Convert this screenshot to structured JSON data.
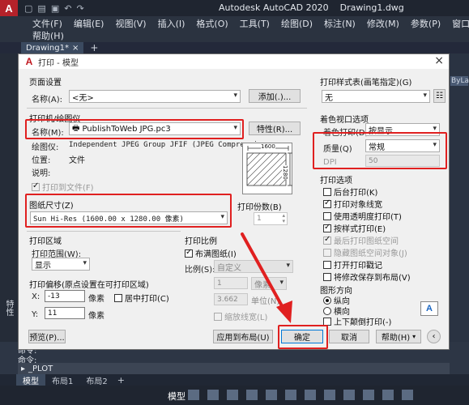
{
  "app": {
    "logo": "A",
    "title": "Autodesk AutoCAD 2020",
    "document": "Drawing1.dwg",
    "menu_row1": [
      "文件(F)",
      "编辑(E)",
      "视图(V)",
      "插入(I)",
      "格式(O)",
      "工具(T)",
      "绘图(D)",
      "标注(N)",
      "修改(M)",
      "参数(P)",
      "窗口(W)"
    ],
    "menu_row2": "帮助(H)",
    "file_tab": "Drawing1*",
    "file_tab_close": "×",
    "file_tab_plus": "+",
    "byla": "ByLa",
    "side_label": "特性",
    "command_history": [
      "命令:",
      "命令:"
    ],
    "command_input": "_PLOT",
    "layout_tabs": [
      "模型",
      "布局1",
      "布局2"
    ],
    "layout_plus": "+",
    "status_model": "模型"
  },
  "dialog": {
    "logo": "A",
    "title": "打印 - 模型",
    "close": "×",
    "page_setup": {
      "section": "页面设置",
      "name_label": "名称(A):",
      "name_value": "<无>",
      "add_button": "添加(.)..."
    },
    "printer": {
      "section": "打印机/绘图仪",
      "name_label": "名称(M):",
      "name_value": "PublishToWeb JPG.pc3",
      "properties_button": "特性(R)...",
      "plotter_label": "绘图仪:",
      "plotter_value": "Independent JPEG Group JFIF (JPEG Compressi...",
      "location_label": "位置:",
      "location_value": "文件",
      "description_label": "说明:",
      "plot_to_file": "打印到文件(F)",
      "preview_dim_h": "1600",
      "preview_dim_v": "1280"
    },
    "paper_size": {
      "section": "图纸尺寸(Z)",
      "value": "Sun Hi-Res (1600.00 x 1280.00 像素)"
    },
    "copies": {
      "section": "打印份数(B)",
      "value": "1"
    },
    "plot_area": {
      "section": "打印区域",
      "what_label": "打印范围(W):",
      "what_value": "显示"
    },
    "plot_offset": {
      "section": "打印偏移(原点设置在可打印区域)",
      "x_label": "X:",
      "x_value": "-13",
      "x_unit": "像素",
      "y_label": "Y:",
      "y_value": "11",
      "y_unit": "像素",
      "center": "居中打印(C)"
    },
    "plot_scale": {
      "section": "打印比例",
      "fit": "布满图纸(I)",
      "scale_label": "比例(S):",
      "scale_value": "自定义",
      "num_value": "1",
      "num_unit": "像素",
      "den_value": "3.662",
      "den_unit": "单位(N)",
      "lineweights": "缩放线宽(L)"
    },
    "style_table": {
      "section": "打印样式表(画笔指定)(G)",
      "value": "无"
    },
    "shaded": {
      "section": "着色视口选项",
      "shade_label": "着色打印(D)",
      "shade_value": "按显示",
      "quality_label": "质量(Q)",
      "quality_value": "常规",
      "dpi_label": "DPI",
      "dpi_value": "50"
    },
    "options": {
      "section": "打印选项",
      "items": [
        {
          "label": "后台打印(K)",
          "checked": false,
          "enabled": true
        },
        {
          "label": "打印对象线宽",
          "checked": true,
          "enabled": true
        },
        {
          "label": "使用透明度打印(T)",
          "checked": false,
          "enabled": true
        },
        {
          "label": "按样式打印(E)",
          "checked": true,
          "enabled": true
        },
        {
          "label": "最后打印图纸空间",
          "checked": true,
          "enabled": false
        },
        {
          "label": "隐藏图纸空间对象(J)",
          "checked": false,
          "enabled": false
        },
        {
          "label": "打开打印戳记",
          "checked": false,
          "enabled": true
        },
        {
          "label": "将修改保存到布局(V)",
          "checked": false,
          "enabled": true
        }
      ]
    },
    "orientation": {
      "section": "图形方向",
      "portrait": "纵向",
      "landscape": "横向",
      "upside_down": "上下颠倒打印(-)",
      "icon_letter": "A"
    },
    "buttons": {
      "preview": "预览(P)...",
      "apply_layout": "应用到布局(U)",
      "ok": "确定",
      "cancel": "取消",
      "help": "帮助(H)",
      "collapse": "‹"
    }
  }
}
